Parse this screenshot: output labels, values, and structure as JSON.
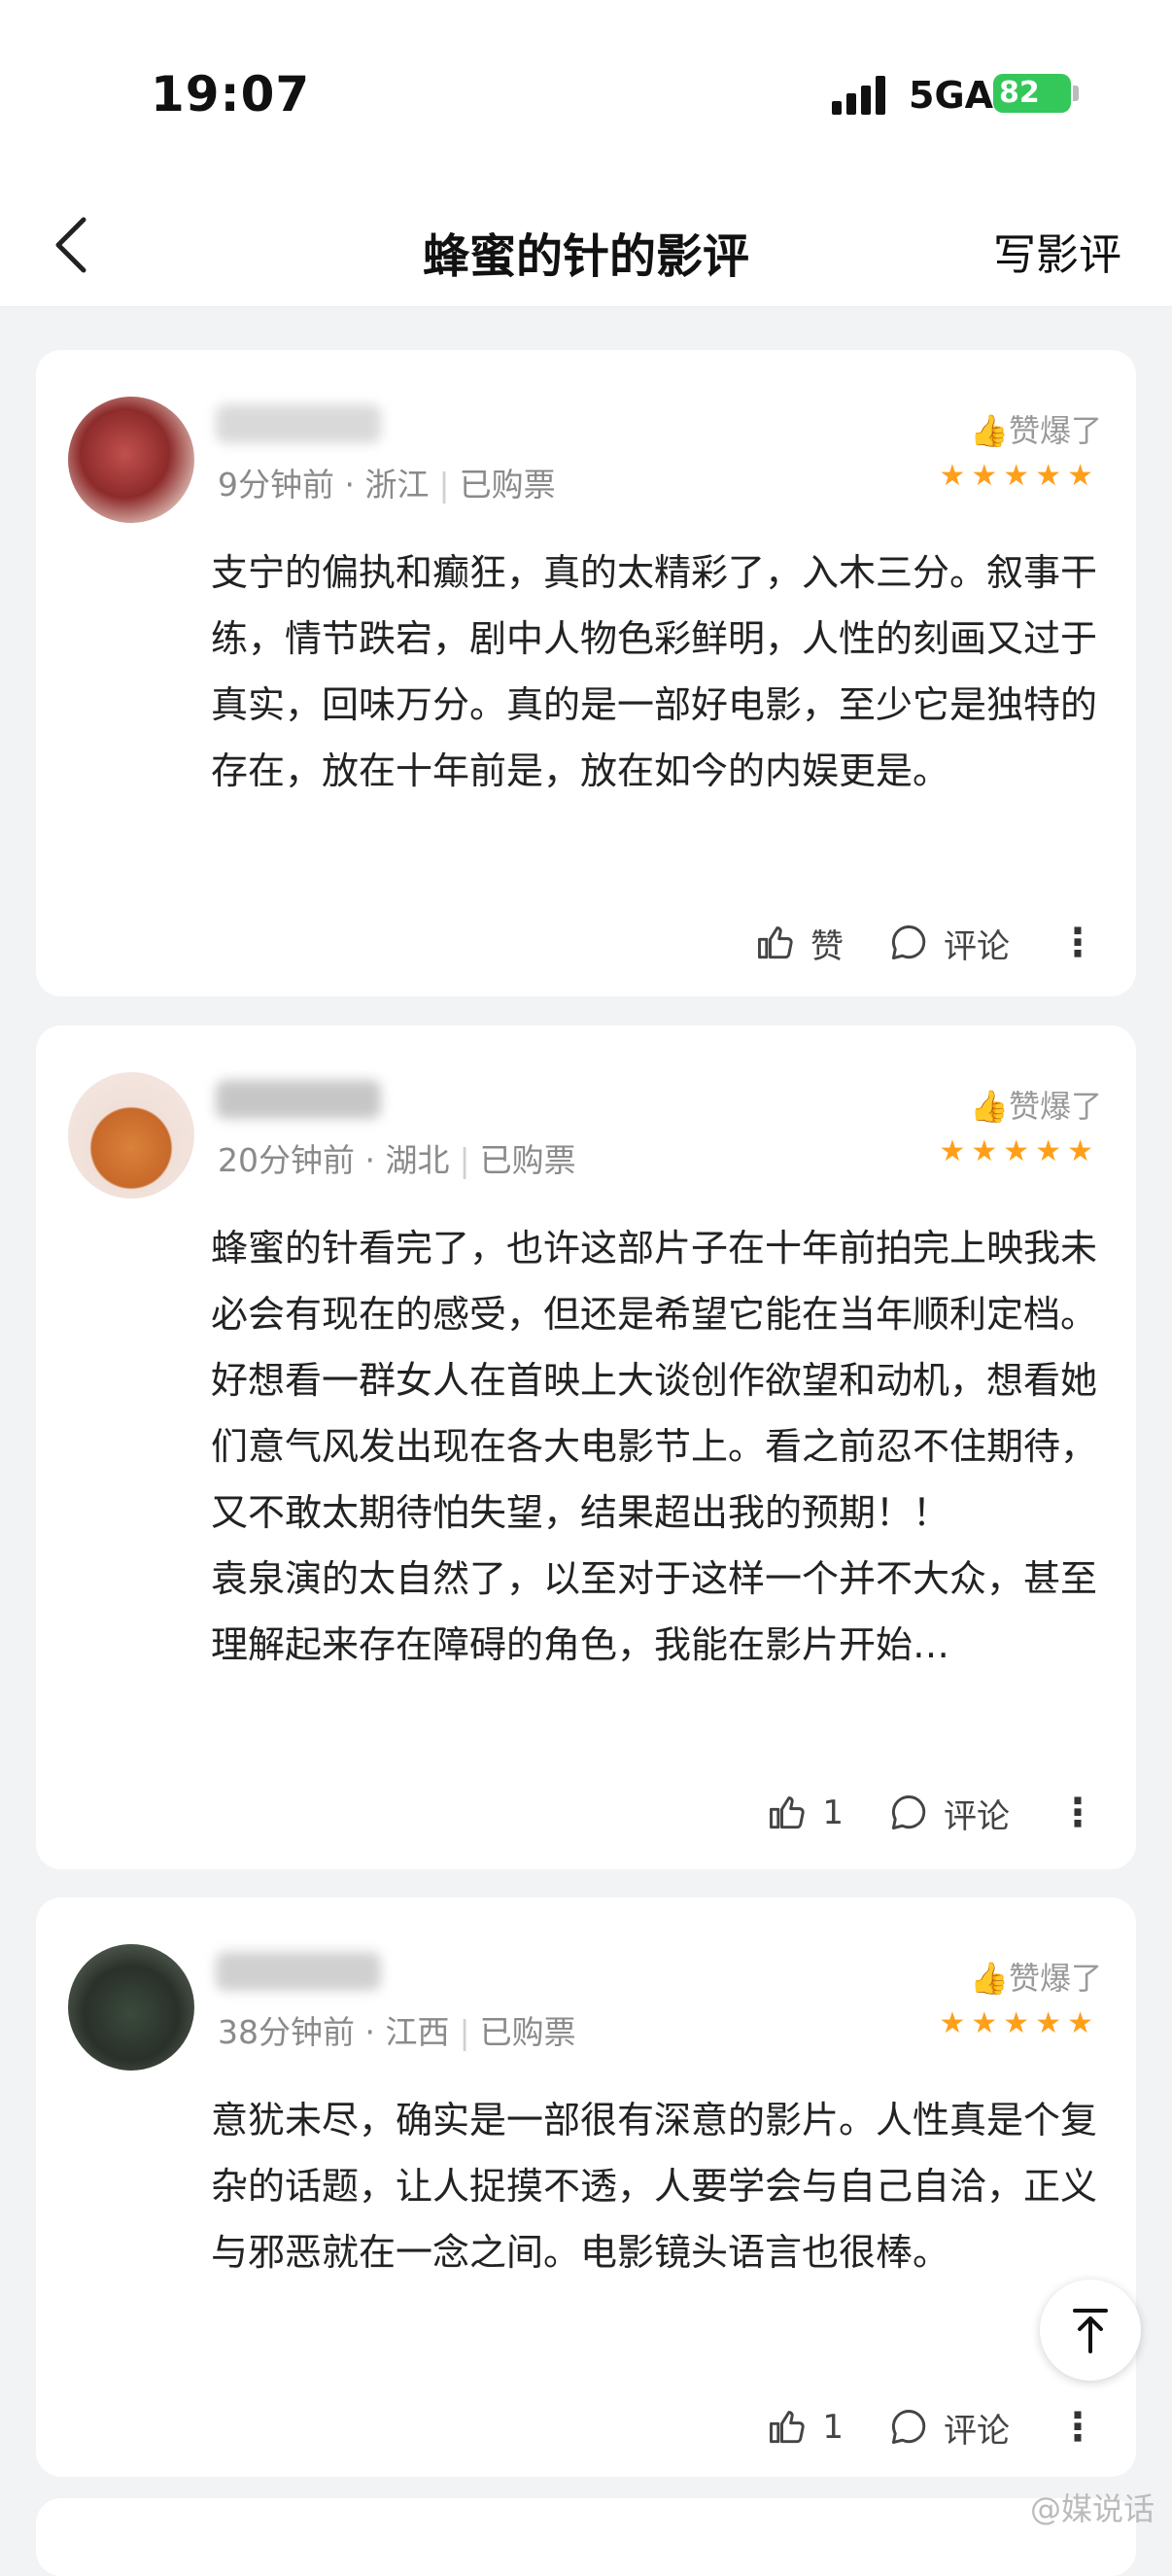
{
  "status_bar": {
    "time": "19:07",
    "network": "5GA",
    "battery": "82"
  },
  "nav": {
    "title": "蜂蜜的针的影评",
    "write_label": "写影评"
  },
  "reviews": [
    {
      "time": "9分钟前",
      "location": "浙江",
      "ticket": "已购票",
      "badge": "赞爆了",
      "rating_stars": 5,
      "content": "支宁的偏执和癫狂，真的太精彩了，入木三分。叙事干练，情节跌宕，剧中人物色彩鲜明，人性的刻画又过于真实，回味万分。真的是一部好电影，至少它是独特的存在，放在十年前是，放在如今的内娱更是。",
      "like_label": "赞",
      "comment_label": "评论"
    },
    {
      "time": "20分钟前",
      "location": "湖北",
      "ticket": "已购票",
      "badge": "赞爆了",
      "rating_stars": 5,
      "content": "蜂蜜的针看完了，也许这部片子在十年前拍完上映我未必会有现在的感受，但还是希望它能在当年顺利定档。好想看一群女人在首映上大谈创作欲望和动机，想看她们意气风发出现在各大电影节上。看之前忍不住期待，又不敢太期待怕失望，结果超出我的预期！！",
      "content2": "袁泉演的太自然了，以至对于这样一个并不大众，甚至理解起来存在障碍的角色，我能在影片开始…",
      "like_label": "1",
      "comment_label": "评论"
    },
    {
      "time": "38分钟前",
      "location": "江西",
      "ticket": "已购票",
      "badge": "赞爆了",
      "rating_stars": 5,
      "content": "意犹未尽，确实是一部很有深意的影片。人性真是个复杂的话题，让人捉摸不透，人要学会与自己自洽，正义与邪恶就在一念之间。电影镜头语言也很棒。",
      "like_label": "1",
      "comment_label": "评论"
    }
  ],
  "stars_text": "★★★★★",
  "watermark": "@媒说话",
  "colors": {
    "accent_star": "#ff9f1a",
    "battery": "#34c759"
  }
}
